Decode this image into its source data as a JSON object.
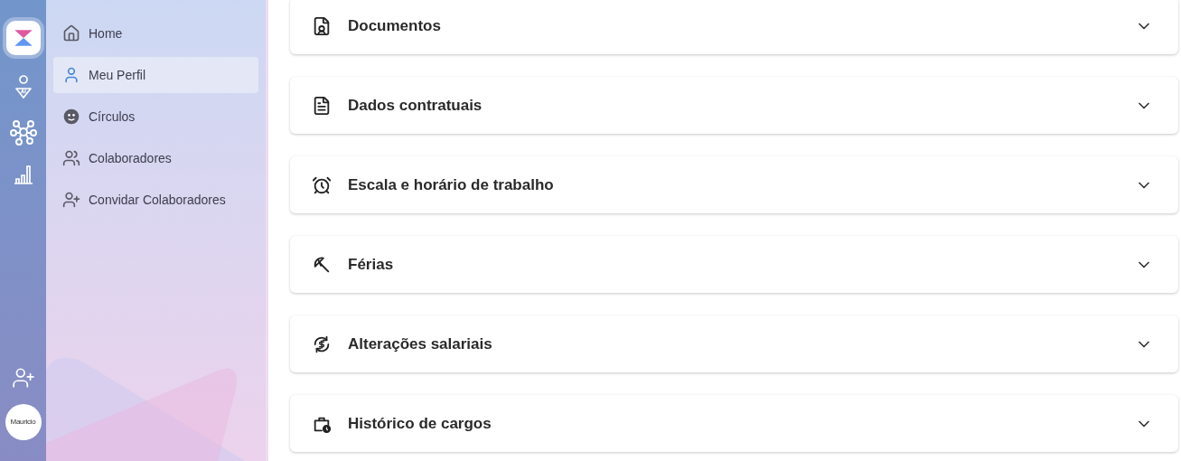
{
  "rail": {
    "avatar": "Mauricio"
  },
  "sidebar": {
    "items": [
      {
        "label": "Home",
        "selected": false
      },
      {
        "label": "Meu Perfil",
        "selected": true
      },
      {
        "label": "Círculos",
        "selected": false
      },
      {
        "label": "Colaboradores",
        "selected": false
      },
      {
        "label": "Convidar Colaboradores",
        "selected": false
      }
    ]
  },
  "sections": [
    {
      "title": "Documentos",
      "expanded": false
    },
    {
      "title": "Dados contratuais",
      "expanded": false
    },
    {
      "title": "Escala e horário de trabalho",
      "expanded": false
    },
    {
      "title": "Férias",
      "expanded": false
    },
    {
      "title": "Alterações salariais",
      "expanded": false
    },
    {
      "title": "Histórico de cargos",
      "expanded": false
    }
  ]
}
